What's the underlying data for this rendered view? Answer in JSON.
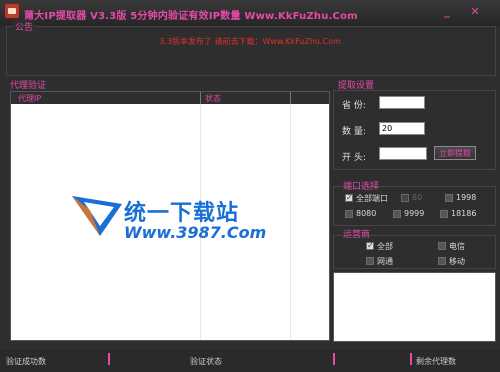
{
  "window": {
    "title": "莆大IP提取器  V3.3版  5分钟内验证有效IP数量   Www.KkFuZhu.Com",
    "min_symbol": "_",
    "close_symbol": "✕"
  },
  "notice": {
    "label": "公告",
    "text": "3.3版本发布了 请前去下载：Www.KkFuZhu.Com"
  },
  "proxy": {
    "label": "代理验证",
    "columns": [
      "代理IP",
      "状态"
    ]
  },
  "watermark": {
    "text_cn": "统一下载站",
    "url": "Www.3987.Com",
    "icon": "triangle-logo-icon"
  },
  "fetch": {
    "label": "提取设置",
    "province_label": "省  份:",
    "province_value": "",
    "count_label": "数  量:",
    "count_value": "20",
    "prefix_label": "开  头:",
    "prefix_value": "",
    "button": "立即提取"
  },
  "ports": {
    "label": "端口选择",
    "options": [
      {
        "label": "全部端口",
        "checked": true
      },
      {
        "label": "80",
        "checked": false,
        "disabled": true
      },
      {
        "label": "1998",
        "checked": false
      },
      {
        "label": "8080",
        "checked": false
      },
      {
        "label": "9999",
        "checked": false
      },
      {
        "label": "18186",
        "checked": false
      }
    ]
  },
  "isp": {
    "label": "运营商",
    "options": [
      {
        "label": "全部",
        "checked": true
      },
      {
        "label": "电信",
        "checked": false
      },
      {
        "label": "网通",
        "checked": false
      },
      {
        "label": "移动",
        "checked": false
      }
    ]
  },
  "status": {
    "success_count": "验证成功数",
    "verify_status": "验证状态",
    "remaining": "剩余代理数"
  },
  "colors": {
    "accent": "#e54aa9",
    "notice_red": "#e0302a",
    "watermark_blue": "#1a6fd6",
    "background": "#2e2e2e"
  }
}
